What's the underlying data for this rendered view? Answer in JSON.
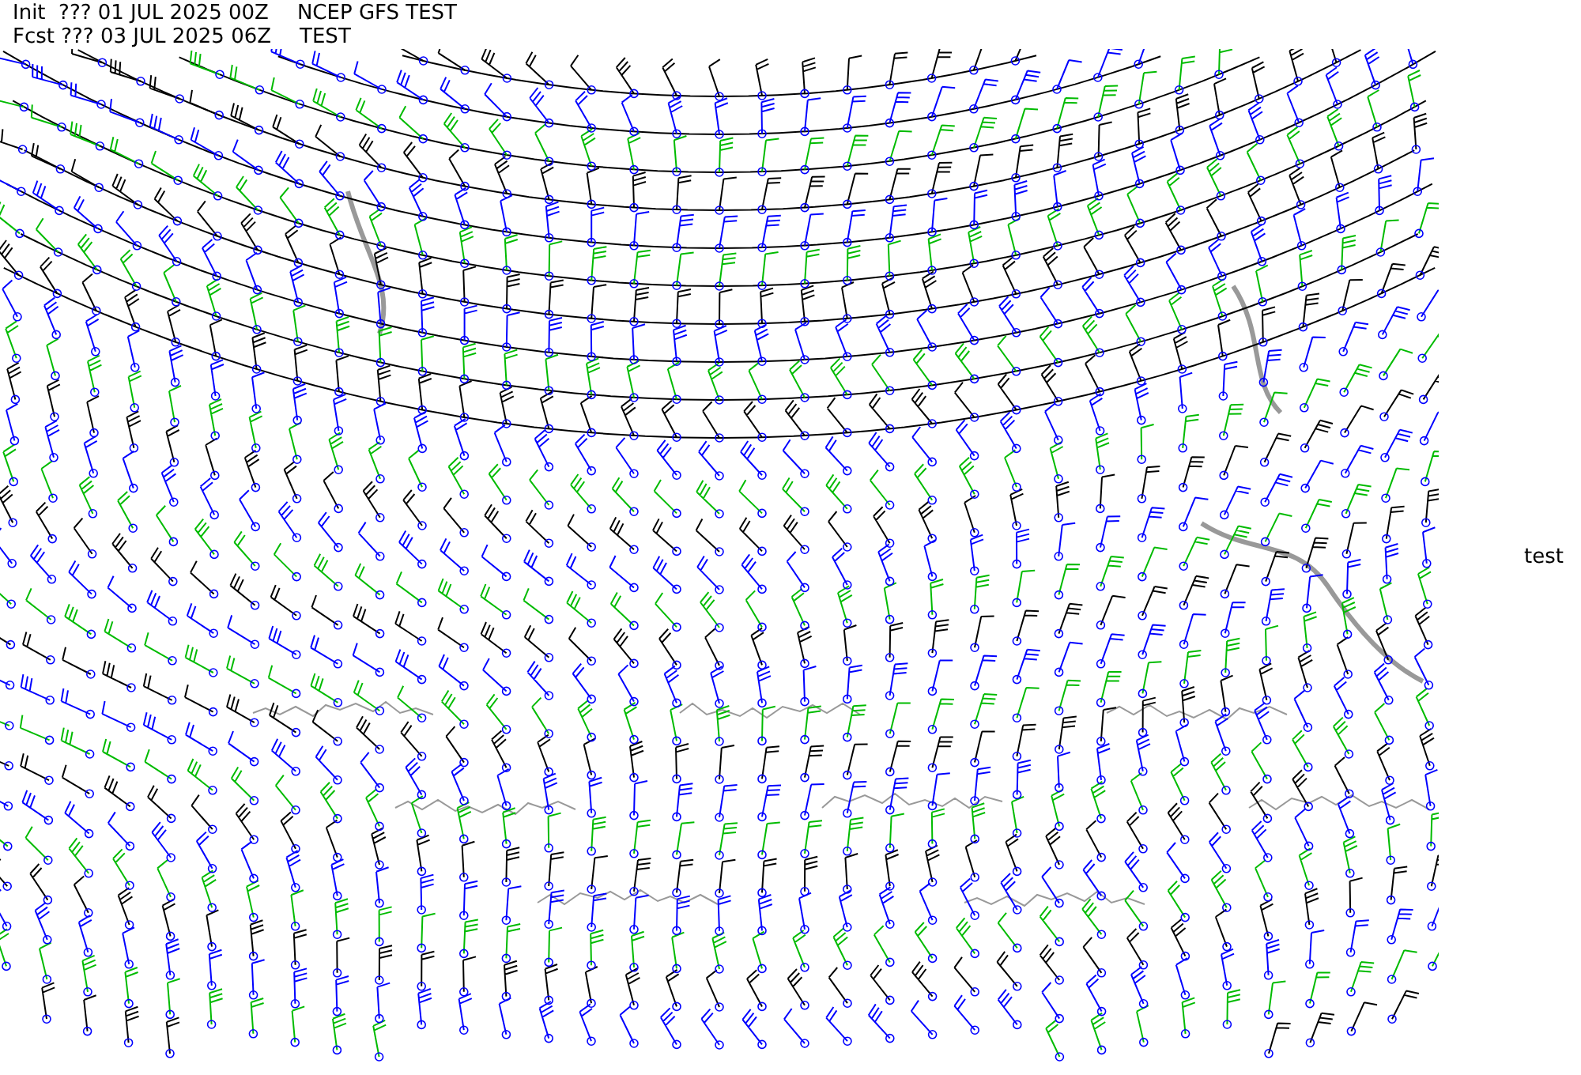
{
  "header": [
    {
      "date_line": "Init  ??? 01 JUL 2025 00Z",
      "title": "NCEP GFS TEST"
    },
    {
      "date_line": "Fcst ??? 03 JUL 2025 06Z",
      "title": "TEST"
    }
  ],
  "side_label": "test"
}
